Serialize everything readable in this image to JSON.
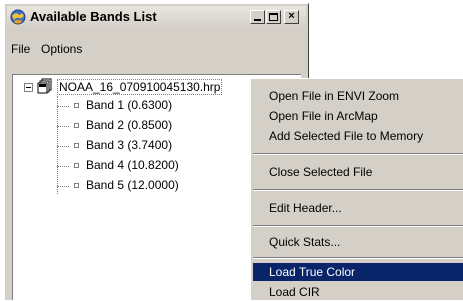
{
  "window": {
    "title": "Available Bands List",
    "icon": "globe-icon",
    "controls": {
      "minimize": "minimize-icon",
      "maximize": "maximize-icon",
      "close": "×"
    }
  },
  "menubar": {
    "items": [
      "File",
      "Options"
    ]
  },
  "tree": {
    "file": "NOAA_16_070910045130.hrp",
    "bands": [
      "Band 1 (0.6300)",
      "Band 2 (0.8500)",
      "Band 3 (3.7400)",
      "Band 4 (10.8200)",
      "Band 5 (12.0000)"
    ]
  },
  "context_menu": {
    "items": [
      "Open File in ENVI Zoom",
      "Open File in ArcMap",
      "Add Selected File to Memory",
      "Close Selected File",
      "Edit Header...",
      "Quick Stats...",
      "Load True Color",
      "Load CIR"
    ],
    "selected": "Load True Color"
  },
  "colors": {
    "highlight": "#0a246a",
    "face": "#d4d0c8"
  }
}
